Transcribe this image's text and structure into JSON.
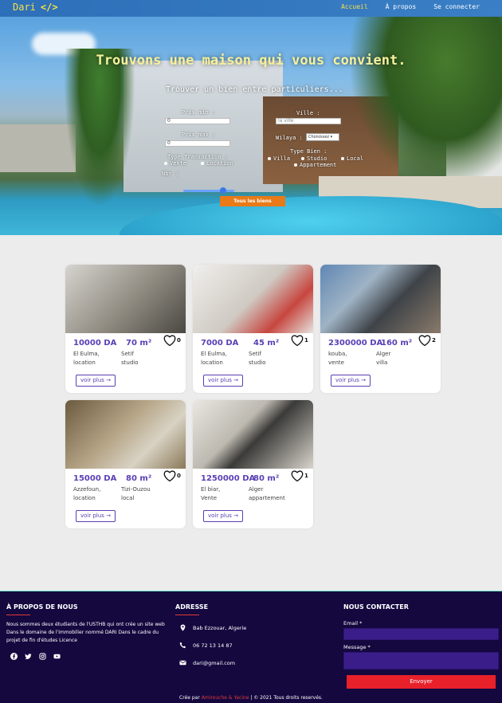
{
  "nav": {
    "brand": "Dari",
    "brand_icon": "</>",
    "links": [
      "Accueil",
      "À propos",
      "Se connecter"
    ],
    "colors": {
      "bar": "#2d6fb8",
      "active": "#f5e24a"
    }
  },
  "hero": {
    "title": "Trouvons une maison qui vous convient.",
    "subtitle": "Trouver un bien entre particuliers...",
    "prix_min_label": "Prix min :",
    "prix_min_value": "0",
    "prix_max_label": "Prix max :",
    "prix_max_value": "0",
    "ville_label": "Ville :",
    "ville_placeholder": "la ville",
    "wilaya_label": "Wilaya :",
    "wilaya_selected": "Choisissez",
    "type_transaction_label": "Type Transaction :",
    "transactions": [
      "Vente",
      "Location"
    ],
    "nbr_label": "Nbr :",
    "type_bien_label": "Type Bien :",
    "biens": [
      "Villa",
      "Studio",
      "Local",
      "Appartement"
    ],
    "button": "Tous les biens"
  },
  "cards": [
    {
      "price": "10000 DA",
      "surface": "70 m²",
      "likes": "0",
      "city": "El Eulma,",
      "transaction": "location",
      "wilaya": "Setif",
      "type": "studio",
      "button": "voir plus →"
    },
    {
      "price": "7000 DA",
      "surface": "45 m²",
      "likes": "1",
      "city": "El Eulma,",
      "transaction": "location",
      "wilaya": "Setif",
      "type": "studio",
      "button": "voir plus →"
    },
    {
      "price": "2300000 DA",
      "surface": "160 m²",
      "likes": "2",
      "city": "kouba,",
      "transaction": "vente",
      "wilaya": "Alger",
      "type": "villa",
      "button": "voir plus →"
    },
    {
      "price": "15000 DA",
      "surface": "80 m²",
      "likes": "0",
      "city": "Azzefoun,",
      "transaction": "location",
      "wilaya": "Tizi-Ouzou",
      "type": "local",
      "button": "voir plus →"
    },
    {
      "price": "1250000 DA",
      "surface": "80 m²",
      "likes": "1",
      "city": "El biar,",
      "transaction": "Vente",
      "wilaya": "Alger",
      "type": "appartement",
      "button": "voir plus →"
    }
  ],
  "footer": {
    "about_title": "À PROPOS DE NOUS",
    "about_text": "Nous sommes deux étudiants de l'USTHB qui ont crée un site web Dans le domaine de l'immobilier nommé DARI Dans le cadre du projet de fin d'études Licence",
    "address_title": "ADRESSE",
    "address": "Bab Ezzouar, Algerie",
    "phone": "06 72 13 14 87",
    "email": "dari@gmail.com",
    "contact_title": "NOUS CONTACTER",
    "email_label": "Email *",
    "message_label": "Message *",
    "send": "Envoyer",
    "credit_prefix": "Crée par ",
    "credit_authors": "Amirouche & Yacine",
    "credit_suffix": " | © 2021 Tous droits reservés.",
    "socials": [
      "facebook-icon",
      "twitter-icon",
      "instagram-icon",
      "youtube-icon"
    ]
  }
}
